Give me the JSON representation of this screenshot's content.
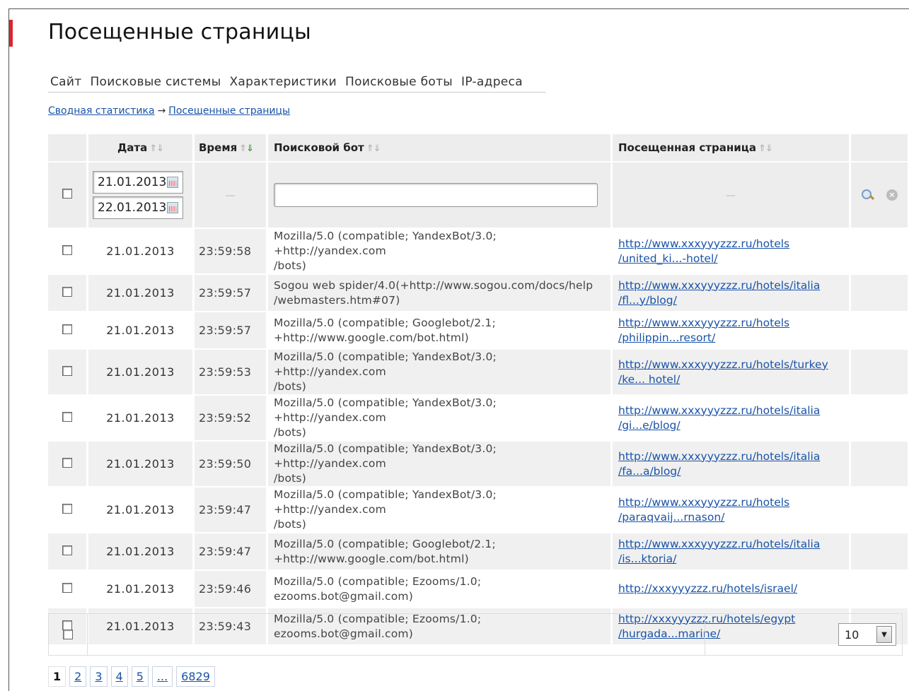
{
  "page": {
    "title": "Посещенные страницы"
  },
  "tabs": [
    {
      "label": "Сайт"
    },
    {
      "label": "Поисковые системы"
    },
    {
      "label": "Характеристики"
    },
    {
      "label": "Поисковые боты"
    },
    {
      "label": "IP-адреса"
    }
  ],
  "breadcrumb": {
    "parent": "Сводная статистика",
    "arrow": "→",
    "current": "Посещенные страницы"
  },
  "table": {
    "headers": {
      "date": "Дата",
      "time": "Время",
      "bot": "Поисковой бот",
      "page": "Посещенная страница"
    },
    "sort_glyphs": {
      "up": "⇑",
      "down": "⇓"
    },
    "filter": {
      "date_from": "21.01.2013",
      "date_to": "22.01.2013",
      "time_placeholder": "—",
      "page_placeholder": "—",
      "bot_value": ""
    },
    "rows": [
      {
        "date": "21.01.2013",
        "time": "23:59:58",
        "bot1": "Mozilla/5.0 (compatible; YandexBot/3.0; +http://yandex.com",
        "bot2": "/bots)",
        "page1": "http://www.xxxyyyzzz.ru/hotels",
        "page2": "/united_ki...-hotel/"
      },
      {
        "date": "21.01.2013",
        "time": "23:59:57",
        "bot1": "Sogou web spider/4.0(+http://www.sogou.com/docs/help",
        "bot2": "/webmasters.htm#07)",
        "page1": "http://www.xxxyyyzzz.ru/hotels/italia",
        "page2": "/fl...y/blog/"
      },
      {
        "date": "21.01.2013",
        "time": "23:59:57",
        "bot1": "Mozilla/5.0 (compatible; Googlebot/2.1;",
        "bot2": "+http://www.google.com/bot.html)",
        "page1": "http://www.xxxyyyzzz.ru/hotels",
        "page2": "/philippin...resort/"
      },
      {
        "date": "21.01.2013",
        "time": "23:59:53",
        "bot1": "Mozilla/5.0 (compatible; YandexBot/3.0; +http://yandex.com",
        "bot2": "/bots)",
        "page1": "http://www.xxxyyyzzz.ru/hotels/turkey",
        "page2": "/ke... hotel/"
      },
      {
        "date": "21.01.2013",
        "time": "23:59:52",
        "bot1": "Mozilla/5.0 (compatible; YandexBot/3.0; +http://yandex.com",
        "bot2": "/bots)",
        "page1": "http://www.xxxyyyzzz.ru/hotels/italia",
        "page2": "/gi...e/blog/"
      },
      {
        "date": "21.01.2013",
        "time": "23:59:50",
        "bot1": "Mozilla/5.0 (compatible; YandexBot/3.0; +http://yandex.com",
        "bot2": "/bots)",
        "page1": "http://www.xxxyyyzzz.ru/hotels/italia",
        "page2": "/fa...a/blog/"
      },
      {
        "date": "21.01.2013",
        "time": "23:59:47",
        "bot1": "Mozilla/5.0 (compatible; YandexBot/3.0; +http://yandex.com",
        "bot2": "/bots)",
        "page1": "http://www.xxxyyyzzz.ru/hotels",
        "page2": "/paraqvaij...rnason/"
      },
      {
        "date": "21.01.2013",
        "time": "23:59:47",
        "bot1": "Mozilla/5.0 (compatible; Googlebot/2.1;",
        "bot2": "+http://www.google.com/bot.html)",
        "page1": "http://www.xxxyyyzzz.ru/hotels/italia",
        "page2": "/is...ktoria/"
      },
      {
        "date": "21.01.2013",
        "time": "23:59:46",
        "bot1": "Mozilla/5.0 (compatible; Ezooms/1.0;",
        "bot2": "ezooms.bot@gmail.com)",
        "page1": "http://xxxyyyzzz.ru/hotels/israel/",
        "page2": ""
      },
      {
        "date": "21.01.2013",
        "time": "23:59:43",
        "bot1": "Mozilla/5.0 (compatible; Ezooms/1.0;",
        "bot2": "ezooms.bot@gmail.com)",
        "page1": "http://xxxyyyzzz.ru/hotels/egypt",
        "page2": "/hurgada...marine/"
      }
    ]
  },
  "footer": {
    "per_page": "10"
  },
  "pager": [
    {
      "label": "1",
      "current": true
    },
    {
      "label": "2"
    },
    {
      "label": "3"
    },
    {
      "label": "4"
    },
    {
      "label": "5"
    },
    {
      "label": "..."
    },
    {
      "label": "6829"
    }
  ],
  "colors": {
    "accent_bar": "#d8262e",
    "link": "#1a53a8",
    "header_bg": "#ededed",
    "alt_row_bg": "#f0f0f0"
  },
  "icons": {
    "calendar": "calendar-icon",
    "search": "search-icon",
    "clear": "clear-icon",
    "select_arrow": "chevron-down-icon"
  }
}
